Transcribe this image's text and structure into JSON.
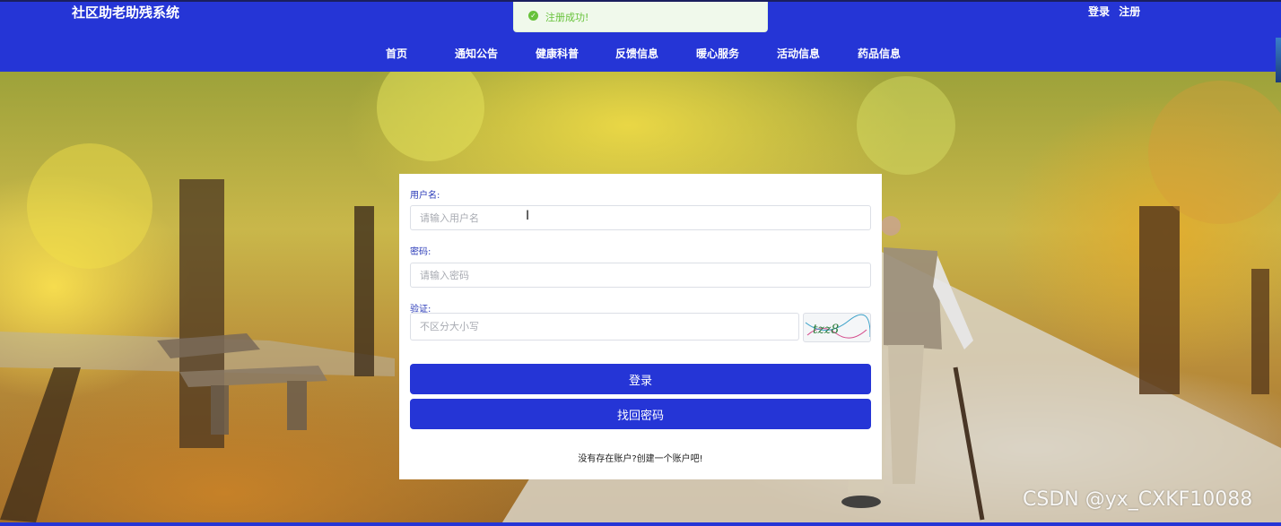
{
  "header": {
    "site_title": "社区助老助残系统",
    "auth": {
      "login": "登录",
      "register": "注册"
    },
    "nav": [
      "首页",
      "通知公告",
      "健康科普",
      "反馈信息",
      "暖心服务",
      "活动信息",
      "药品信息"
    ]
  },
  "toast": {
    "message": "注册成功!",
    "icon": "check-circle-icon",
    "color": "#67c23a"
  },
  "login_form": {
    "username_label": "用户名:",
    "username_placeholder": "请输入用户名",
    "password_label": "密码:",
    "password_placeholder": "请输入密码",
    "captcha_label": "验证:",
    "captcha_placeholder": "不区分大小写",
    "captcha_text": "tzz8",
    "login_button": "登录",
    "recover_button": "找回密码",
    "register_hint": "没有存在账户?创建一个账户吧!"
  },
  "watermark": "CSDN @yx_CXKF10088",
  "colors": {
    "primary": "#2535d6",
    "success": "#67c23a",
    "card_bg": "#ffffff"
  }
}
